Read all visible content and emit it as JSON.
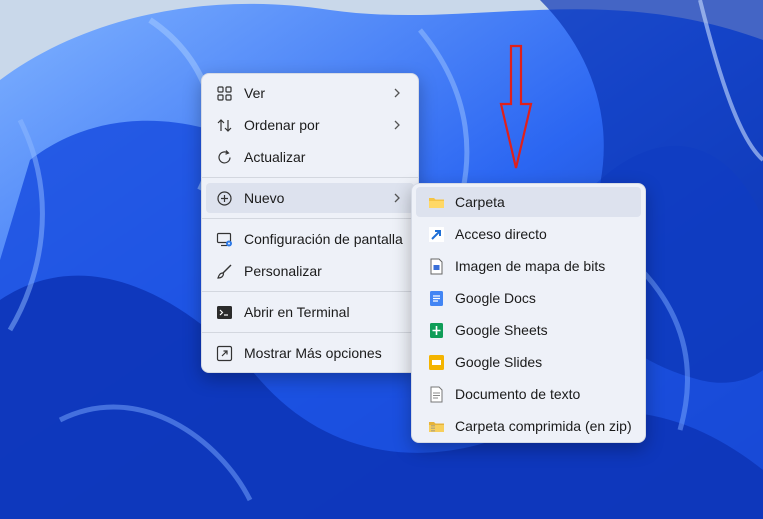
{
  "context_menu": {
    "items": [
      {
        "label": "Ver",
        "icon": "grid-icon",
        "submenu": true
      },
      {
        "label": "Ordenar por",
        "icon": "sort-icon",
        "submenu": true
      },
      {
        "label": "Actualizar",
        "icon": "refresh-icon",
        "submenu": false
      },
      {
        "label": "Nuevo",
        "icon": "plus-circle-icon",
        "submenu": true,
        "highlighted": true
      },
      {
        "label": "Configuración de pantalla",
        "icon": "display-settings-icon",
        "submenu": false
      },
      {
        "label": "Personalizar",
        "icon": "brush-icon",
        "submenu": false
      },
      {
        "label": "Abrir en Terminal",
        "icon": "terminal-icon",
        "submenu": false
      },
      {
        "label": "Mostrar Más opciones",
        "icon": "more-options-icon",
        "submenu": false
      }
    ]
  },
  "new_submenu": {
    "items": [
      {
        "label": "Carpeta",
        "icon": "folder-icon",
        "highlighted": true
      },
      {
        "label": "Acceso directo",
        "icon": "shortcut-icon"
      },
      {
        "label": "Imagen de mapa de bits",
        "icon": "bitmap-icon"
      },
      {
        "label": "Google Docs",
        "icon": "google-docs-icon"
      },
      {
        "label": "Google Sheets",
        "icon": "google-sheets-icon"
      },
      {
        "label": "Google Slides",
        "icon": "google-slides-icon"
      },
      {
        "label": "Documento de texto",
        "icon": "text-document-icon"
      },
      {
        "label": "Carpeta comprimida (en zip)",
        "icon": "zip-folder-icon"
      }
    ]
  },
  "colors": {
    "menu_bg": "#eef1f8",
    "highlight": "#dde2ee",
    "annotation_arrow": "#e0201b",
    "docs_blue": "#4285f4",
    "sheets_green": "#0f9d58",
    "slides_yellow": "#f4b400"
  }
}
